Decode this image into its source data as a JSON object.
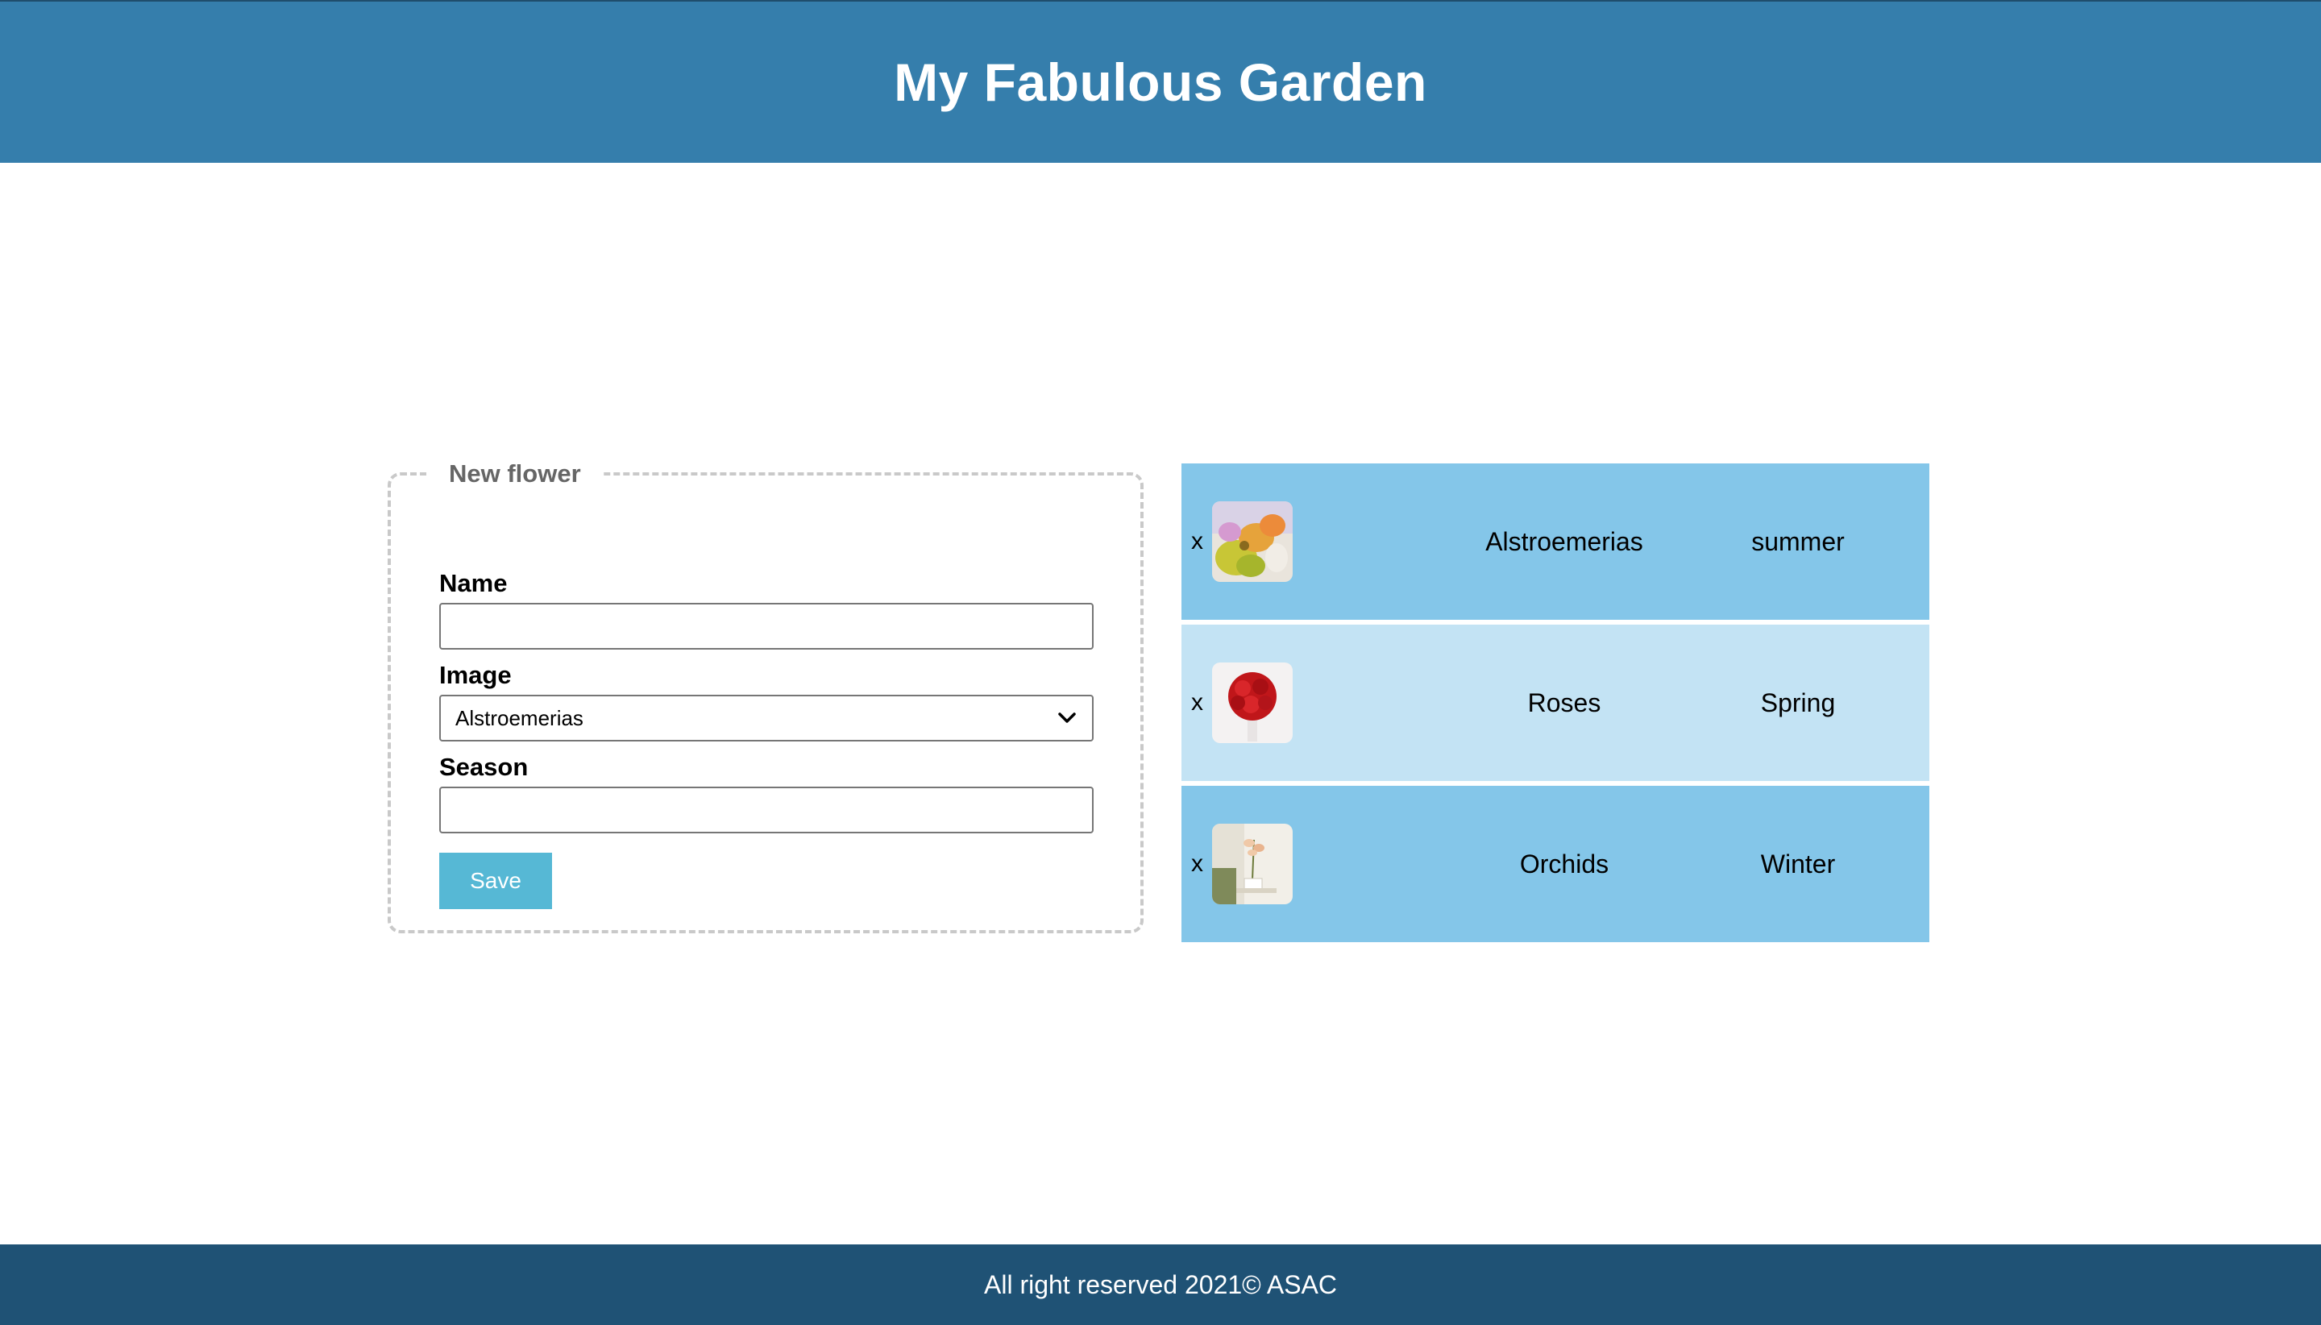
{
  "header": {
    "title": "My Fabulous Garden"
  },
  "form": {
    "legend": "New flower",
    "name_label": "Name",
    "name_value": "",
    "image_label": "Image",
    "image_selected": "Alstroemerias",
    "season_label": "Season",
    "season_value": "",
    "save_label": "Save"
  },
  "flowers": [
    {
      "remove": "x",
      "name": "Alstroemerias",
      "season": "summer",
      "image_icon": "alstroemerias-thumbnail"
    },
    {
      "remove": "x",
      "name": "Roses",
      "season": "Spring",
      "image_icon": "roses-thumbnail"
    },
    {
      "remove": "x",
      "name": "Orchids",
      "season": "Winter",
      "image_icon": "orchids-thumbnail"
    }
  ],
  "footer": {
    "text": "All right reserved 2021© ASAC"
  },
  "colors": {
    "header_bg": "#357eac",
    "footer_bg": "#1f5275",
    "row_dark": "#84c6e9",
    "row_light": "#c3e3f4",
    "save_button": "#56b8d5"
  }
}
